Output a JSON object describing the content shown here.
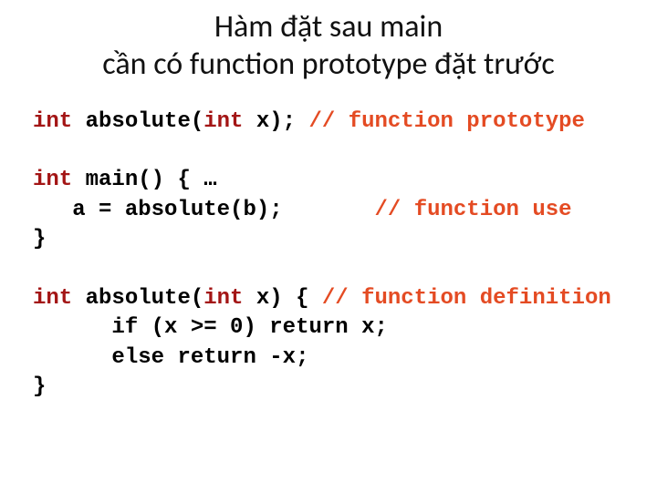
{
  "title_line1": "Hàm đặt sau main",
  "title_line2": "cần có function prototype đặt trước",
  "code": {
    "kw_int": "int",
    "absolute": "absolute",
    "proto_params": "(",
    "proto_close": " x);",
    "proto_comment": " // function prototype",
    "main_open": " main() { …",
    "use_line_prefix": "   a = ",
    "use_call": "absolute(b);",
    "use_pad": "       ",
    "use_comment": "// function use",
    "closebrace": "}",
    "def_params": "(",
    "def_close": " x) { ",
    "def_comment": "// function definition",
    "if_lead": "      ",
    "kw_if": "if",
    "if_cond": " (x >= 0) ",
    "kw_return1": "return",
    "ret_x": " x;",
    "else_lead": "      ",
    "kw_else": "else",
    "space": " ",
    "kw_return2": "return",
    "ret_negx": " -x;"
  }
}
